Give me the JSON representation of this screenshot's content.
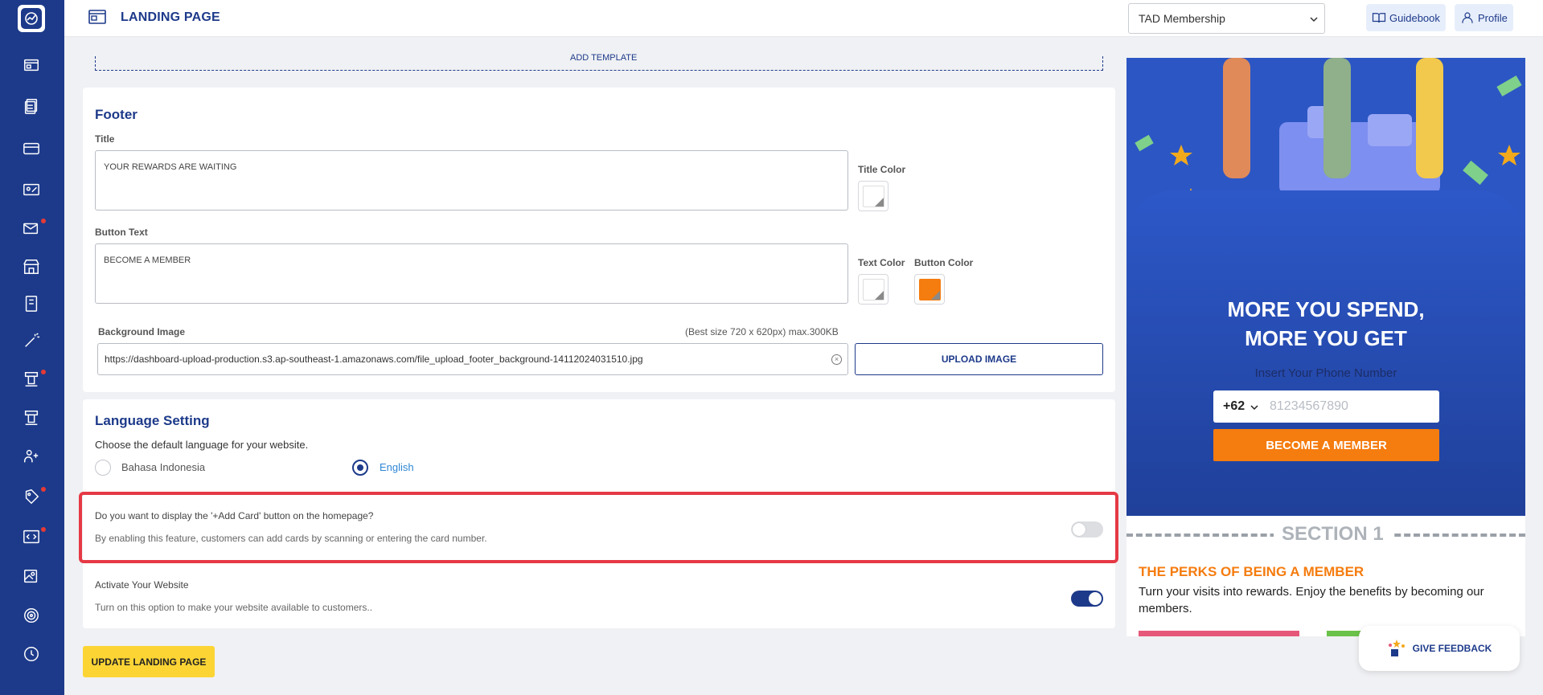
{
  "topbar": {
    "page_title": "LANDING PAGE",
    "membership_select": "TAD Membership",
    "guidebook_label": "Guidebook",
    "profile_label": "Profile"
  },
  "template_strip_label": "ADD TEMPLATE",
  "footer": {
    "section_title": "Footer",
    "title_label": "Title",
    "title_value": "YOUR REWARDS ARE WAITING",
    "title_color_label": "Title Color",
    "button_text_label": "Button Text",
    "button_text_value": "BECOME A MEMBER",
    "text_color_label": "Text Color",
    "button_color_label": "Button Color",
    "button_color": "#f57c0f",
    "bg_image_label": "Background Image",
    "bg_image_hint": "(Best size 720 x 620px) max.300KB",
    "bg_image_url": "https://dashboard-upload-production.s3.ap-southeast-1.amazonaws.com/file_upload_footer_background-14112024031510.jpg",
    "upload_button": "UPLOAD IMAGE"
  },
  "language": {
    "section_title": "Language Setting",
    "description": "Choose the default language for your website.",
    "options": [
      "Bahasa Indonesia",
      "English"
    ],
    "selected": "English"
  },
  "add_card": {
    "question": "Do you want to display the '+Add Card' button on the homepage?",
    "description": "By enabling this feature, customers can add cards by scanning or entering the card number.",
    "enabled": false
  },
  "activate": {
    "title": "Activate Your Website",
    "description": "Turn on this option to make your website available to customers..",
    "enabled": true
  },
  "update_button": "UPDATE LANDING PAGE",
  "preview": {
    "headline_line1": "MORE YOU SPEND,",
    "headline_line2": "MORE YOU GET",
    "insert_phone": "Insert Your Phone Number",
    "country_code": "+62",
    "phone_placeholder": "81234567890",
    "cta": "BECOME A MEMBER",
    "section_label": "SECTION 1",
    "perks_title": "THE PERKS OF BEING A MEMBER",
    "perks_text": "Turn your visits into rewards. Enjoy the benefits by becoming our members."
  },
  "feedback_label": "GIVE FEEDBACK",
  "colors": {
    "primary": "#1d3a8a",
    "accent_orange": "#f57c0f",
    "highlight_red": "#e53945",
    "update_yellow": "#fcd535"
  }
}
